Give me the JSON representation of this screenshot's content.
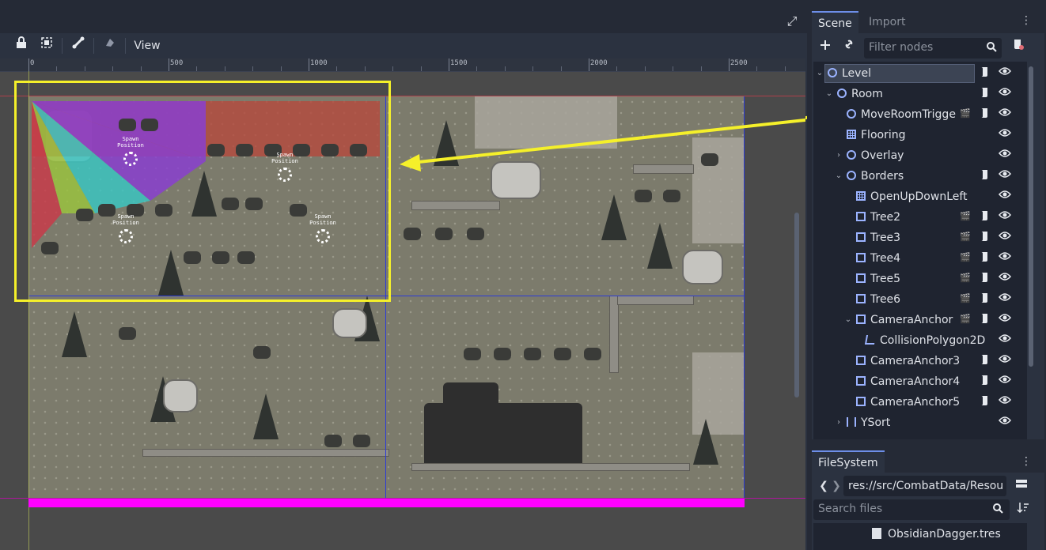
{
  "editor": {
    "toolbar": {
      "lock_icon": "lock-icon",
      "group_icon": "group-icon",
      "bone_icon": "bone-icon",
      "skeleton_icon": "skeleton-icon",
      "view_label": "View"
    },
    "maximize_icon": "maximize-icon",
    "ruler": {
      "labels": [
        "0",
        "500",
        "1000",
        "1500",
        "2000",
        "2500"
      ]
    },
    "spawns": [
      {
        "label": "Spawn\nPosition"
      },
      {
        "label": "Spawn\nPosition"
      },
      {
        "label": "Spawn\nPosition"
      },
      {
        "label": "Spawn\nPosition"
      }
    ],
    "colors": {
      "selection": "#f5f02a",
      "kill_zone": "#ff00ff",
      "room_bounds": "#2d3bd6",
      "camera_area": "#b54a3e"
    }
  },
  "scene_panel": {
    "tabs": [
      "Scene",
      "Import"
    ],
    "filter_placeholder": "Filter nodes",
    "nodes": [
      {
        "name": "Level",
        "depth": 0,
        "arrow": "down",
        "icon": "circle",
        "script": true,
        "selected": true
      },
      {
        "name": "Room",
        "depth": 1,
        "arrow": "down",
        "icon": "circle",
        "script": true
      },
      {
        "name": "MoveRoomTrigge",
        "depth": 2,
        "arrow": "",
        "icon": "circle",
        "scene": true,
        "script": true
      },
      {
        "name": "Flooring",
        "depth": 2,
        "arrow": "",
        "icon": "grid"
      },
      {
        "name": "Overlay",
        "depth": 2,
        "arrow": "right",
        "icon": "circle"
      },
      {
        "name": "Borders",
        "depth": 2,
        "arrow": "down",
        "icon": "circle",
        "script": true
      },
      {
        "name": "OpenUpDownLeft",
        "depth": 3,
        "arrow": "",
        "icon": "grid"
      },
      {
        "name": "Tree2",
        "depth": 3,
        "arrow": "",
        "icon": "dashed",
        "scene": true,
        "script": true
      },
      {
        "name": "Tree3",
        "depth": 3,
        "arrow": "",
        "icon": "dashed",
        "scene": true,
        "script": true
      },
      {
        "name": "Tree4",
        "depth": 3,
        "arrow": "",
        "icon": "dashed",
        "scene": true,
        "script": true
      },
      {
        "name": "Tree5",
        "depth": 3,
        "arrow": "",
        "icon": "dashed",
        "scene": true,
        "script": true
      },
      {
        "name": "Tree6",
        "depth": 3,
        "arrow": "",
        "icon": "dashed",
        "scene": true,
        "script": true
      },
      {
        "name": "CameraAnchor",
        "depth": 3,
        "arrow": "down",
        "icon": "cam",
        "scene": true,
        "script": true
      },
      {
        "name": "CollisionPolygon2D",
        "depth": 4,
        "arrow": "",
        "icon": "poly"
      },
      {
        "name": "CameraAnchor3",
        "depth": 3,
        "arrow": "",
        "icon": "cam",
        "script": true
      },
      {
        "name": "CameraAnchor4",
        "depth": 3,
        "arrow": "",
        "icon": "cam",
        "script": true
      },
      {
        "name": "CameraAnchor5",
        "depth": 3,
        "arrow": "",
        "icon": "cam",
        "script": true
      },
      {
        "name": "YSort",
        "depth": 2,
        "arrow": "right",
        "icon": "ysort"
      }
    ]
  },
  "filesystem_panel": {
    "tab": "FileSystem",
    "path": "res://src/CombatData/Resou",
    "search_placeholder": "Search files",
    "items": [
      "ObsidianDagger.tres"
    ]
  }
}
